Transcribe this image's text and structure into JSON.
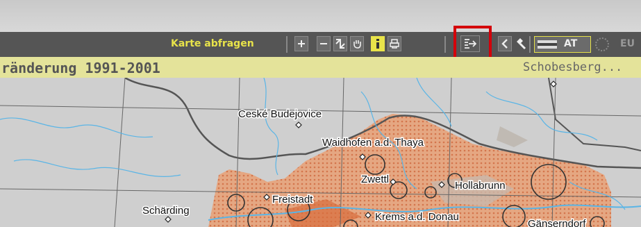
{
  "toolbar": {
    "query_label": "Karte abfragen",
    "tools": [
      {
        "name": "zoom-in-icon"
      },
      {
        "name": "zoom-out-icon"
      },
      {
        "name": "full-extent-icon"
      },
      {
        "name": "pan-hand-icon"
      },
      {
        "name": "info-icon",
        "active": true
      },
      {
        "name": "print-icon"
      },
      {
        "name": "export-icon",
        "highlighted": true
      },
      {
        "name": "back-icon"
      },
      {
        "name": "hammer-icon"
      }
    ],
    "scale_at_label": "AT",
    "scale_eu_label": "EU",
    "accent_color": "#e8e34a",
    "highlight_color": "#d4000a"
  },
  "header": {
    "title": "ränderung 1991-2001",
    "user": "Schobesberg..."
  },
  "map": {
    "places": [
      {
        "name": "Ceské Budejovice"
      },
      {
        "name": "Waidhofen a.d. Thaya"
      },
      {
        "name": "Zwettl"
      },
      {
        "name": "Hollabrunn"
      },
      {
        "name": "Freistadt"
      },
      {
        "name": "Schärding"
      },
      {
        "name": "Krems a.d. Donau"
      },
      {
        "name": "Gänserndorf"
      }
    ]
  }
}
